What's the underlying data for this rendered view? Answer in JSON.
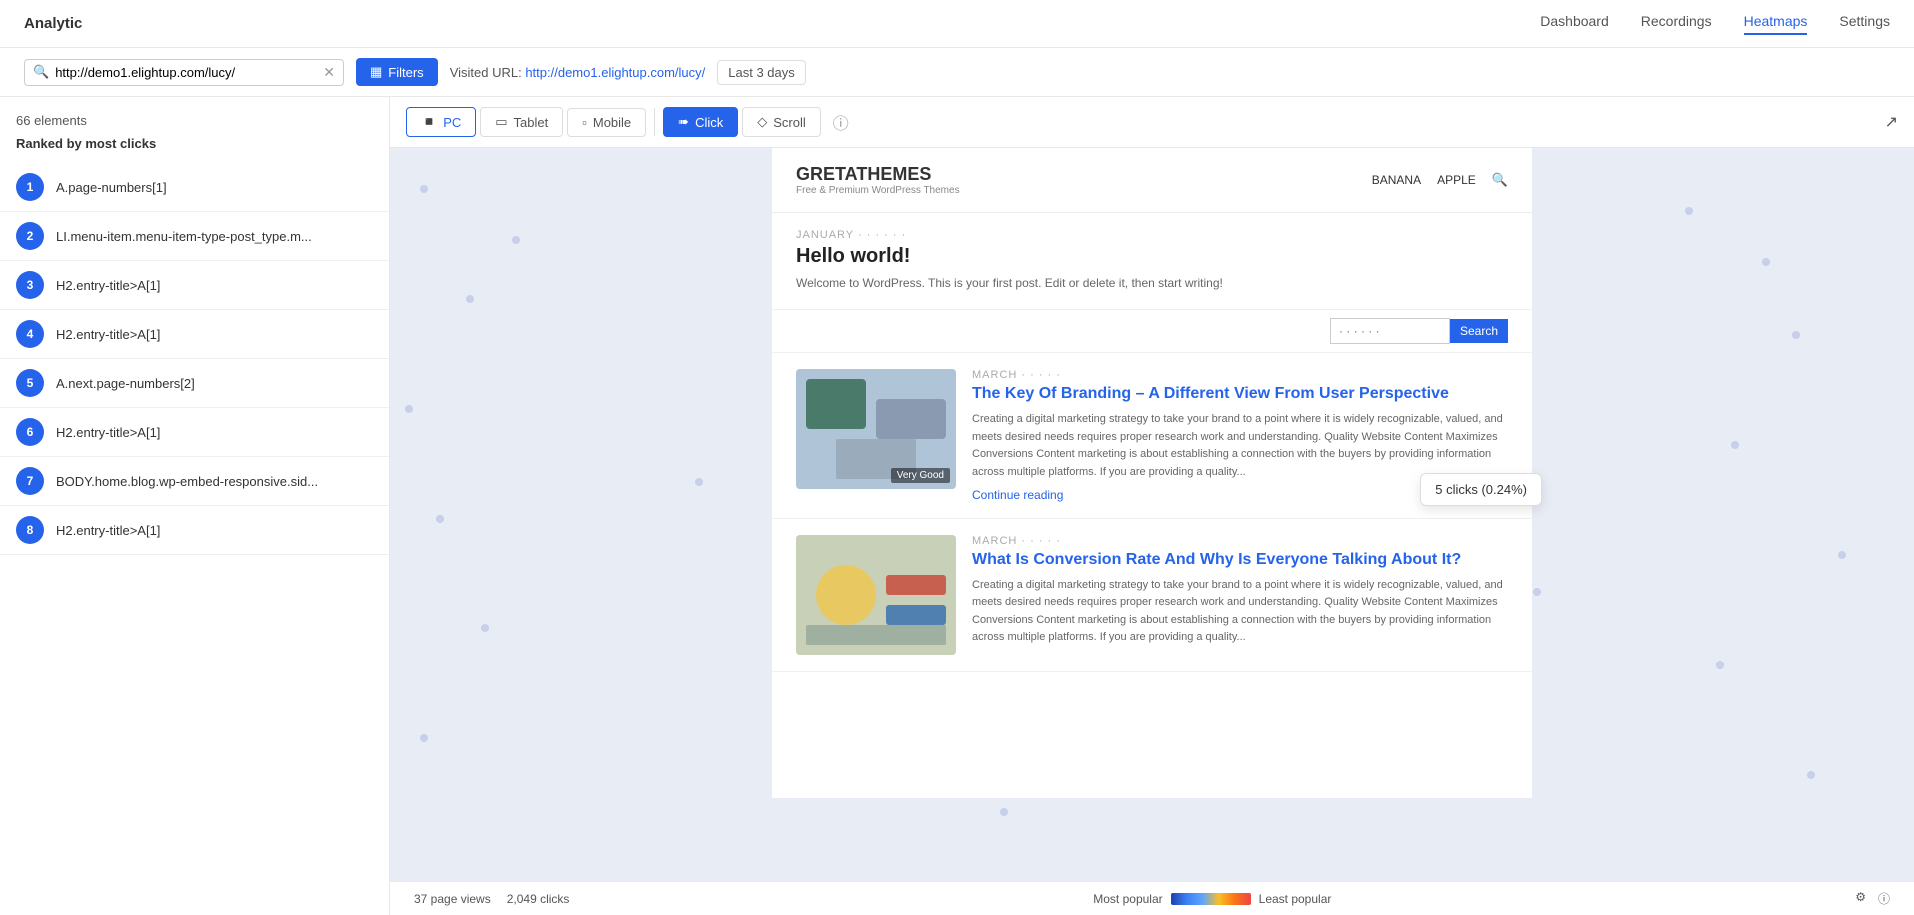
{
  "app": {
    "title": "Analytic"
  },
  "nav": {
    "links": [
      "Dashboard",
      "Recordings",
      "Heatmaps",
      "Settings"
    ],
    "active": "Heatmaps"
  },
  "toolbar": {
    "url": "http://demo1.elightup.com/lucy/",
    "filters_label": "Filters",
    "visited_url_label": "Visited URL:",
    "visited_url": "http://demo1.elightup.com/lucy/",
    "last_days": "Last 3 days"
  },
  "sidebar": {
    "count": "66 elements",
    "ranked_label": "Ranked by most clicks",
    "items": [
      {
        "num": 1,
        "label": "A.page-numbers[1]"
      },
      {
        "num": 2,
        "label": "LI.menu-item.menu-item-type-post_type.m..."
      },
      {
        "num": 3,
        "label": "H2.entry-title>A[1]"
      },
      {
        "num": 4,
        "label": "H2.entry-title>A[1]"
      },
      {
        "num": 5,
        "label": "A.next.page-numbers[2]"
      },
      {
        "num": 6,
        "label": "H2.entry-title>A[1]"
      },
      {
        "num": 7,
        "label": "BODY.home.blog.wp-embed-responsive.sid..."
      },
      {
        "num": 8,
        "label": "H2.entry-title>A[1]"
      }
    ]
  },
  "device_tabs": [
    "PC",
    "Tablet",
    "Mobile"
  ],
  "view_tabs": [
    "Click",
    "Scroll"
  ],
  "active_device": "PC",
  "active_view": "Click",
  "blog": {
    "logo": "GRETATHEMES",
    "tagline": "Free & Premium WordPress Themes",
    "nav_items": [
      "BANANA",
      "APPLE"
    ],
    "posts": [
      {
        "date": "JANUARY · · · · · ·",
        "title": "Hello world!",
        "excerpt": "Welcome to WordPress. This is your first post. Edit or delete it, then start writing!"
      },
      {
        "date": "MARCH · · · · ·",
        "title": "The Key Of Branding – A Different View From User Perspective",
        "excerpt": "Creating a digital marketing strategy to take your brand to a point where it is widely recognizable, valued, and meets desired needs requires proper research work and understanding. Quality Website Content Maximizes Conversions Content marketing is about establishing a connection with the buyers by providing information across multiple platforms. If you are providing a quality...",
        "continue": "Continue reading",
        "thumb_label": "Very Good"
      },
      {
        "date": "MARCH · · · · ·",
        "title": "What Is Conversion Rate And Why Is Everyone Talking About It?",
        "excerpt": "Creating a digital marketing strategy to take your brand to a point where it is widely recognizable, valued, and meets desired needs requires proper research work and understanding. Quality Website Content Maximizes Conversions Content marketing is about establishing a connection with the buyers by providing information across multiple platforms. If you are providing a quality..."
      }
    ]
  },
  "tooltip": {
    "text": "5 clicks (0.24%)"
  },
  "search_widget": {
    "placeholder": "· · · · · ·",
    "button_label": "Search"
  },
  "bottom": {
    "page_views": "37 page views",
    "clicks": "2,049 clicks",
    "most_popular": "Most popular",
    "least_popular": "Least popular"
  }
}
